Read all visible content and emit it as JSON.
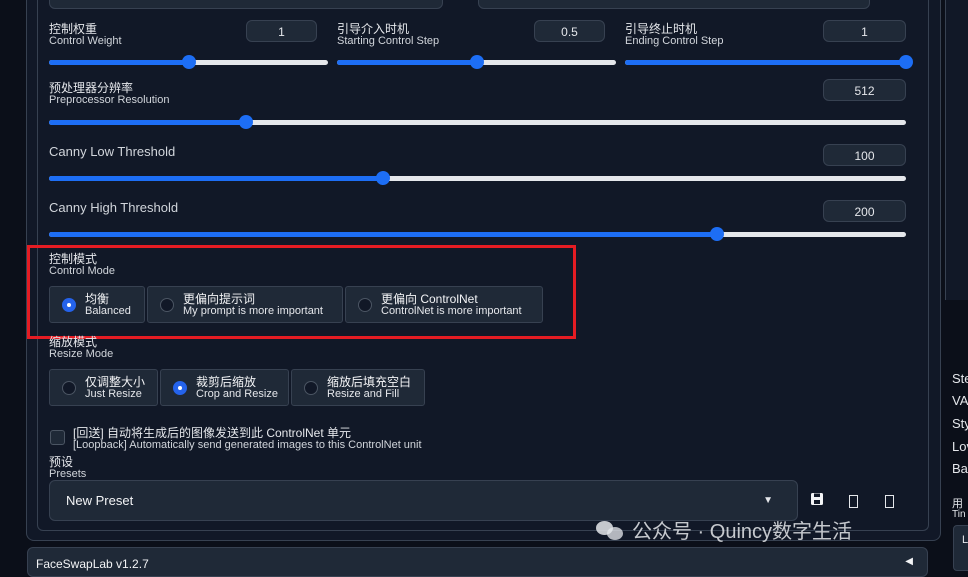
{
  "control_weight": {
    "zh": "控制权重",
    "en": "Control Weight",
    "value": "1",
    "fraction": 0.5
  },
  "starting_step": {
    "zh": "引导介入时机",
    "en": "Starting Control Step",
    "value": "0.5",
    "fraction": 0.5
  },
  "ending_step": {
    "zh": "引导终止时机",
    "en": "Ending Control Step",
    "value": "1",
    "fraction": 1.0
  },
  "preprocessor_resolution": {
    "zh": "预处理器分辨率",
    "en": "Preprocessor Resolution",
    "value": "512",
    "fraction": 0.23
  },
  "canny_low": {
    "label": "Canny Low Threshold",
    "value": "100",
    "fraction": 0.39
  },
  "canny_high": {
    "label": "Canny High Threshold",
    "value": "200",
    "fraction": 0.78
  },
  "control_mode": {
    "zh": "控制模式",
    "en": "Control Mode",
    "options": [
      {
        "zh": "均衡",
        "en": "Balanced",
        "selected": true
      },
      {
        "zh": "更偏向提示词",
        "en": "My prompt is more important",
        "selected": false
      },
      {
        "zh": "更偏向 ControlNet",
        "en": "ControlNet is more important",
        "selected": false
      }
    ]
  },
  "resize_mode": {
    "zh": "缩放模式",
    "en": "Resize Mode",
    "options": [
      {
        "zh": "仅调整大小",
        "en": "Just Resize",
        "selected": false
      },
      {
        "zh": "裁剪后缩放",
        "en": "Crop and Resize",
        "selected": true
      },
      {
        "zh": "缩放后填充空白",
        "en": "Resize and Fill",
        "selected": false
      }
    ]
  },
  "loopback": {
    "zh": "[回送] 自动将生成后的图像发送到此 ControlNet 单元",
    "en": "[Loopback] Automatically send generated images to this ControlNet unit",
    "checked": false
  },
  "presets": {
    "zh": "预设",
    "en": "Presets",
    "selected": "New Preset"
  },
  "footer": {
    "title": "FaceSwapLab v1.2.7"
  },
  "right_panel": {
    "items": [
      "Ste",
      "VA",
      "Sty",
      "Lov",
      "Ba"
    ],
    "bottom": "用",
    "bottom2": "Tin",
    "box": "L"
  },
  "watermark": {
    "text": "公众号 · Quincy数字生活"
  },
  "colors": {
    "accent": "#1d6ef5",
    "highlight": "#e51c23",
    "background": "#0b0f19"
  }
}
